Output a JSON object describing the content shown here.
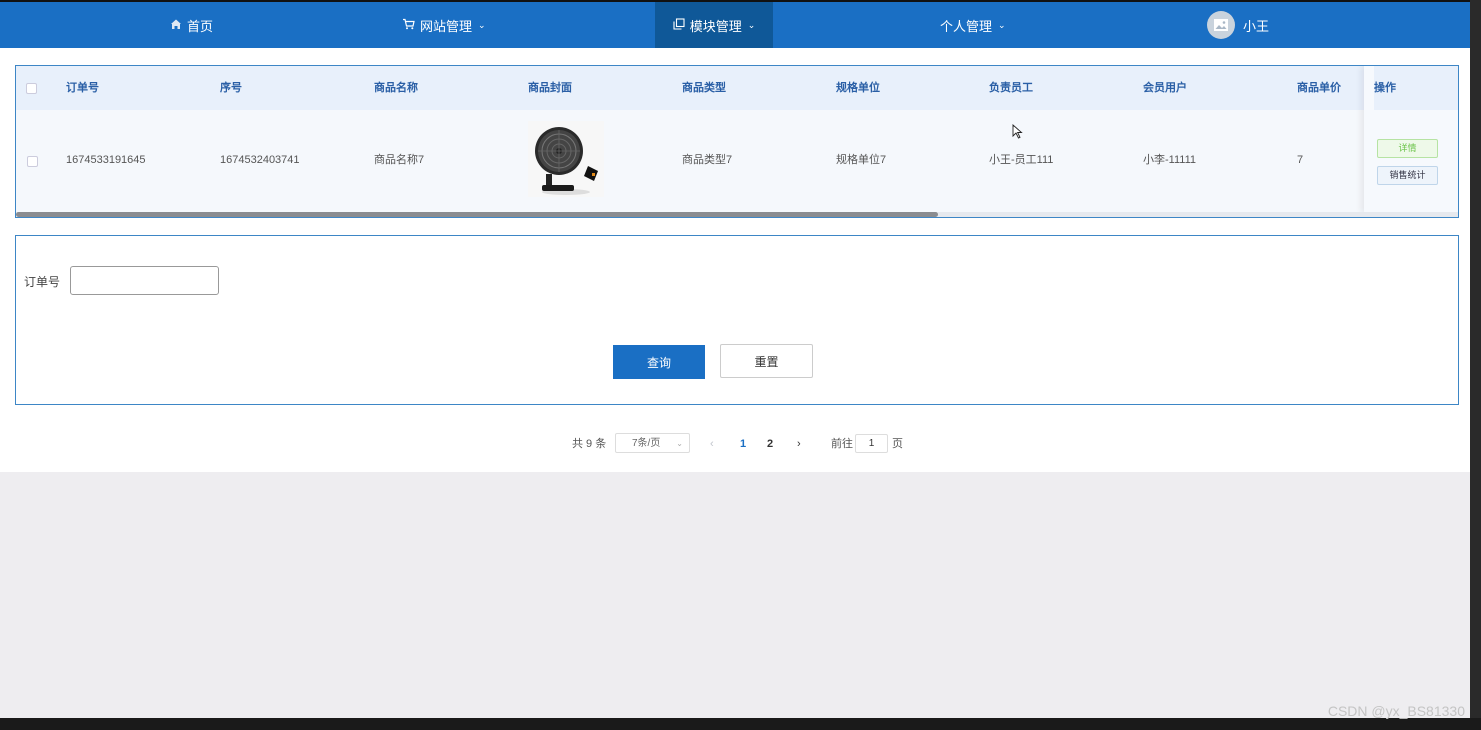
{
  "nav": {
    "home": "首页",
    "site_mgmt": "网站管理",
    "module_mgmt": "模块管理",
    "personal_mgmt": "个人管理",
    "username": "小王",
    "icons": {
      "home": "home-icon",
      "site": "cart-icon",
      "module": "copy-icon",
      "caret": "chevron-down-icon",
      "avatar": "image-icon"
    }
  },
  "table": {
    "headers": [
      "订单号",
      "序号",
      "商品名称",
      "商品封面",
      "商品类型",
      "规格单位",
      "负责员工",
      "会员用户",
      "商品单价",
      "操作"
    ],
    "row": {
      "order_no": "1674533191645",
      "seq": "1674532403741",
      "name": "商品名称7",
      "type": "商品类型7",
      "unit": "规格单位7",
      "staff": "小王-员工111",
      "member": "小李-11111",
      "price": "7",
      "btn_detail": "详情",
      "btn_stats": "销售统计"
    }
  },
  "search": {
    "label": "订单号",
    "value": "",
    "query_label": "查询",
    "reset_label": "重置"
  },
  "pagination": {
    "total": "共 9 条",
    "page_size": "7条/页",
    "pages": [
      "1",
      "2"
    ],
    "current": "1",
    "goto_prefix": "前往",
    "goto_value": "1",
    "goto_suffix": "页"
  },
  "watermark": "CSDN @yx_BS81330",
  "colors": {
    "primary": "#1a6fc4",
    "header_text": "#2a5fa6",
    "success": "#6cc44a"
  }
}
